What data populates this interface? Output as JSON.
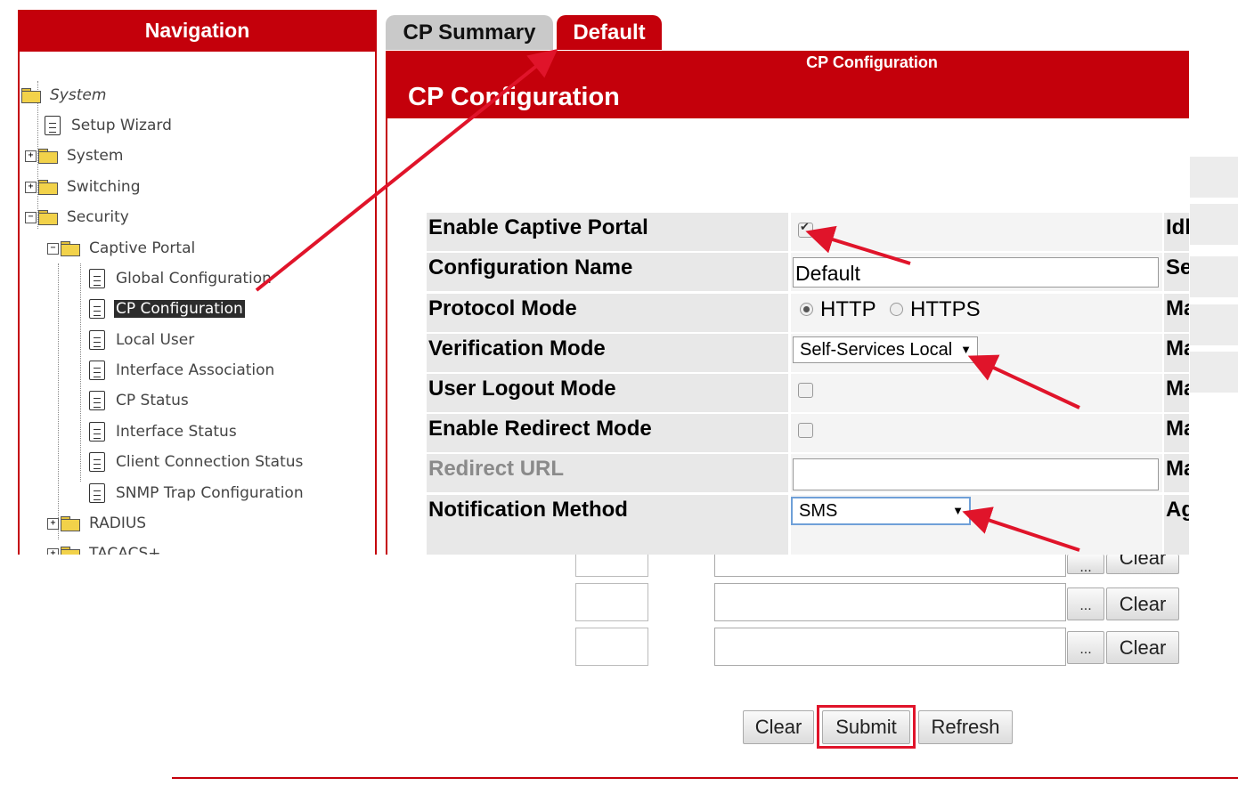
{
  "nav": {
    "title": "Navigation",
    "tree": [
      {
        "label": "System",
        "italic": true
      },
      {
        "label": "Setup Wizard"
      },
      {
        "label": "System"
      },
      {
        "label": "Switching"
      },
      {
        "label": "Security"
      },
      {
        "label": "Captive Portal"
      },
      {
        "label": "Global Configuration"
      },
      {
        "label": "CP Configuration",
        "selected": true
      },
      {
        "label": "Local User"
      },
      {
        "label": "Interface Association"
      },
      {
        "label": "CP Status"
      },
      {
        "label": "Interface Status"
      },
      {
        "label": "Client Connection Status"
      },
      {
        "label": "SNMP Trap Configuration"
      },
      {
        "label": "RADIUS"
      },
      {
        "label": "TACACS+"
      }
    ]
  },
  "tabs": [
    {
      "label": "CP Summary",
      "active": false
    },
    {
      "label": "Default",
      "active": true
    }
  ],
  "config": {
    "header_small": "CP Configuration",
    "title": "CP Configuration",
    "rows": {
      "enable_captive_portal": {
        "label": "Enable Captive Portal",
        "checked": true,
        "side": "Idl"
      },
      "configuration_name": {
        "label": "Configuration Name",
        "value": "Default",
        "side": "Se"
      },
      "protocol_mode": {
        "label": "Protocol Mode",
        "options": [
          "HTTP",
          "HTTPS"
        ],
        "selected": "HTTP",
        "side": "Ma"
      },
      "verification_mode": {
        "label": "Verification Mode",
        "value": "Self-Services Local",
        "side": "Ma"
      },
      "user_logout_mode": {
        "label": "User Logout Mode",
        "checked": false,
        "side": "Ma"
      },
      "enable_redirect_mode": {
        "label": "Enable Redirect Mode",
        "checked": false,
        "side": "Ma"
      },
      "redirect_url": {
        "label": "Redirect URL",
        "value": "",
        "side": "Ma"
      },
      "notification_method": {
        "label": "Notification Method",
        "value": "SMS",
        "side": "Ag"
      }
    }
  },
  "lower_table": {
    "rows": [
      {
        "browse": "...",
        "clear": "Clear"
      },
      {
        "browse": "...",
        "clear": "Clear"
      },
      {
        "browse": "...",
        "clear": "Clear"
      }
    ]
  },
  "actions": {
    "clear": "Clear",
    "submit": "Submit",
    "refresh": "Refresh"
  },
  "colors": {
    "brand_red": "#c4000b",
    "annotation_red": "#e0142a"
  }
}
